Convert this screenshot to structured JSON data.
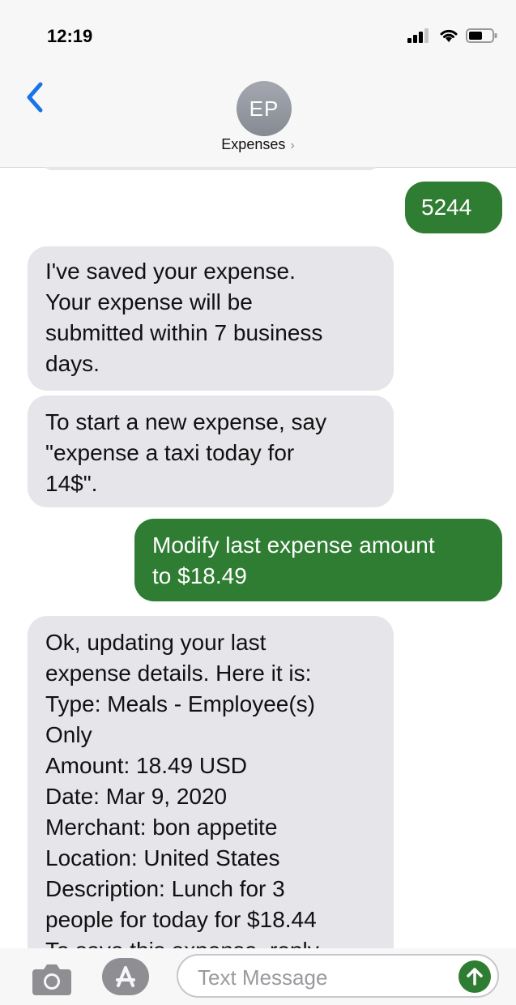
{
  "status_bar": {
    "time": "12:19"
  },
  "header": {
    "avatar_initials": "EP",
    "contact_name": "Expenses",
    "contact_chevron": "›"
  },
  "messages": [
    {
      "direction": "out",
      "text": "5244"
    },
    {
      "direction": "in",
      "text": "I've saved your expense.\nYour expense will be\nsubmitted within 7 business\ndays."
    },
    {
      "direction": "in",
      "text": "To start a new expense, say\n\"expense a taxi today for\n14$\"."
    },
    {
      "direction": "out",
      "text": "Modify last expense amount\nto $18.49"
    },
    {
      "direction": "in",
      "text": "Ok, updating your last\nexpense details. Here it is:\nType: Meals - Employee(s)\nOnly\nAmount: 18.49 USD\nDate: Mar 9, 2020\nMerchant: bon appetite\nLocation: United States\nDescription: Lunch for 3\npeople for today for $18.44\nTo save this expense, reply"
    }
  ],
  "input_bar": {
    "placeholder": "Text Message"
  },
  "colors": {
    "outgoing_bubble": "#2f7d32",
    "incoming_bubble": "#e5e5ea",
    "accent_blue": "#1a73e8"
  },
  "icons": [
    "back-chevron-icon",
    "camera-icon",
    "app-store-icon",
    "send-arrow-icon",
    "signal-icon",
    "wifi-icon",
    "battery-icon"
  ]
}
